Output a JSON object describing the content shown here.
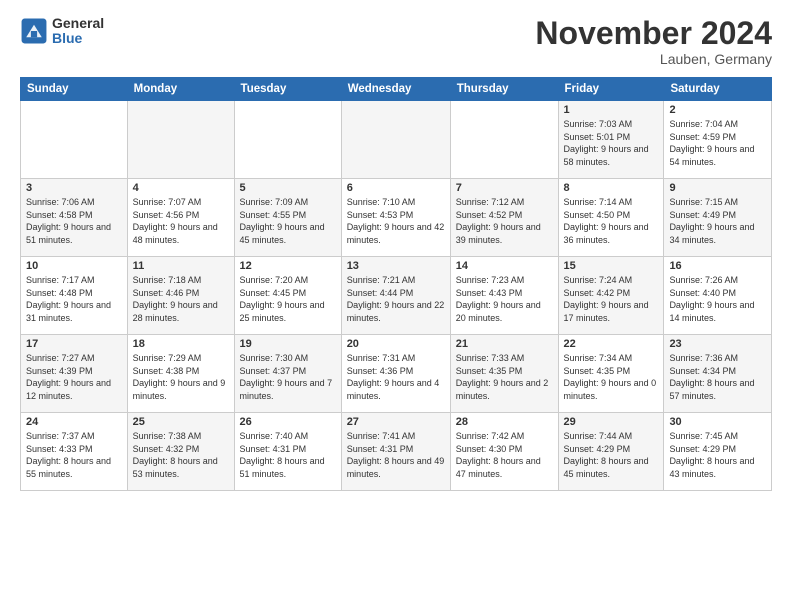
{
  "header": {
    "logo_general": "General",
    "logo_blue": "Blue",
    "month_title": "November 2024",
    "location": "Lauben, Germany"
  },
  "weekdays": [
    "Sunday",
    "Monday",
    "Tuesday",
    "Wednesday",
    "Thursday",
    "Friday",
    "Saturday"
  ],
  "weeks": [
    [
      {
        "day": "",
        "info": ""
      },
      {
        "day": "",
        "info": ""
      },
      {
        "day": "",
        "info": ""
      },
      {
        "day": "",
        "info": ""
      },
      {
        "day": "",
        "info": ""
      },
      {
        "day": "1",
        "info": "Sunrise: 7:03 AM\nSunset: 5:01 PM\nDaylight: 9 hours and 58 minutes."
      },
      {
        "day": "2",
        "info": "Sunrise: 7:04 AM\nSunset: 4:59 PM\nDaylight: 9 hours and 54 minutes."
      }
    ],
    [
      {
        "day": "3",
        "info": "Sunrise: 7:06 AM\nSunset: 4:58 PM\nDaylight: 9 hours and 51 minutes."
      },
      {
        "day": "4",
        "info": "Sunrise: 7:07 AM\nSunset: 4:56 PM\nDaylight: 9 hours and 48 minutes."
      },
      {
        "day": "5",
        "info": "Sunrise: 7:09 AM\nSunset: 4:55 PM\nDaylight: 9 hours and 45 minutes."
      },
      {
        "day": "6",
        "info": "Sunrise: 7:10 AM\nSunset: 4:53 PM\nDaylight: 9 hours and 42 minutes."
      },
      {
        "day": "7",
        "info": "Sunrise: 7:12 AM\nSunset: 4:52 PM\nDaylight: 9 hours and 39 minutes."
      },
      {
        "day": "8",
        "info": "Sunrise: 7:14 AM\nSunset: 4:50 PM\nDaylight: 9 hours and 36 minutes."
      },
      {
        "day": "9",
        "info": "Sunrise: 7:15 AM\nSunset: 4:49 PM\nDaylight: 9 hours and 34 minutes."
      }
    ],
    [
      {
        "day": "10",
        "info": "Sunrise: 7:17 AM\nSunset: 4:48 PM\nDaylight: 9 hours and 31 minutes."
      },
      {
        "day": "11",
        "info": "Sunrise: 7:18 AM\nSunset: 4:46 PM\nDaylight: 9 hours and 28 minutes."
      },
      {
        "day": "12",
        "info": "Sunrise: 7:20 AM\nSunset: 4:45 PM\nDaylight: 9 hours and 25 minutes."
      },
      {
        "day": "13",
        "info": "Sunrise: 7:21 AM\nSunset: 4:44 PM\nDaylight: 9 hours and 22 minutes."
      },
      {
        "day": "14",
        "info": "Sunrise: 7:23 AM\nSunset: 4:43 PM\nDaylight: 9 hours and 20 minutes."
      },
      {
        "day": "15",
        "info": "Sunrise: 7:24 AM\nSunset: 4:42 PM\nDaylight: 9 hours and 17 minutes."
      },
      {
        "day": "16",
        "info": "Sunrise: 7:26 AM\nSunset: 4:40 PM\nDaylight: 9 hours and 14 minutes."
      }
    ],
    [
      {
        "day": "17",
        "info": "Sunrise: 7:27 AM\nSunset: 4:39 PM\nDaylight: 9 hours and 12 minutes."
      },
      {
        "day": "18",
        "info": "Sunrise: 7:29 AM\nSunset: 4:38 PM\nDaylight: 9 hours and 9 minutes."
      },
      {
        "day": "19",
        "info": "Sunrise: 7:30 AM\nSunset: 4:37 PM\nDaylight: 9 hours and 7 minutes."
      },
      {
        "day": "20",
        "info": "Sunrise: 7:31 AM\nSunset: 4:36 PM\nDaylight: 9 hours and 4 minutes."
      },
      {
        "day": "21",
        "info": "Sunrise: 7:33 AM\nSunset: 4:35 PM\nDaylight: 9 hours and 2 minutes."
      },
      {
        "day": "22",
        "info": "Sunrise: 7:34 AM\nSunset: 4:35 PM\nDaylight: 9 hours and 0 minutes."
      },
      {
        "day": "23",
        "info": "Sunrise: 7:36 AM\nSunset: 4:34 PM\nDaylight: 8 hours and 57 minutes."
      }
    ],
    [
      {
        "day": "24",
        "info": "Sunrise: 7:37 AM\nSunset: 4:33 PM\nDaylight: 8 hours and 55 minutes."
      },
      {
        "day": "25",
        "info": "Sunrise: 7:38 AM\nSunset: 4:32 PM\nDaylight: 8 hours and 53 minutes."
      },
      {
        "day": "26",
        "info": "Sunrise: 7:40 AM\nSunset: 4:31 PM\nDaylight: 8 hours and 51 minutes."
      },
      {
        "day": "27",
        "info": "Sunrise: 7:41 AM\nSunset: 4:31 PM\nDaylight: 8 hours and 49 minutes."
      },
      {
        "day": "28",
        "info": "Sunrise: 7:42 AM\nSunset: 4:30 PM\nDaylight: 8 hours and 47 minutes."
      },
      {
        "day": "29",
        "info": "Sunrise: 7:44 AM\nSunset: 4:29 PM\nDaylight: 8 hours and 45 minutes."
      },
      {
        "day": "30",
        "info": "Sunrise: 7:45 AM\nSunset: 4:29 PM\nDaylight: 8 hours and 43 minutes."
      }
    ]
  ]
}
